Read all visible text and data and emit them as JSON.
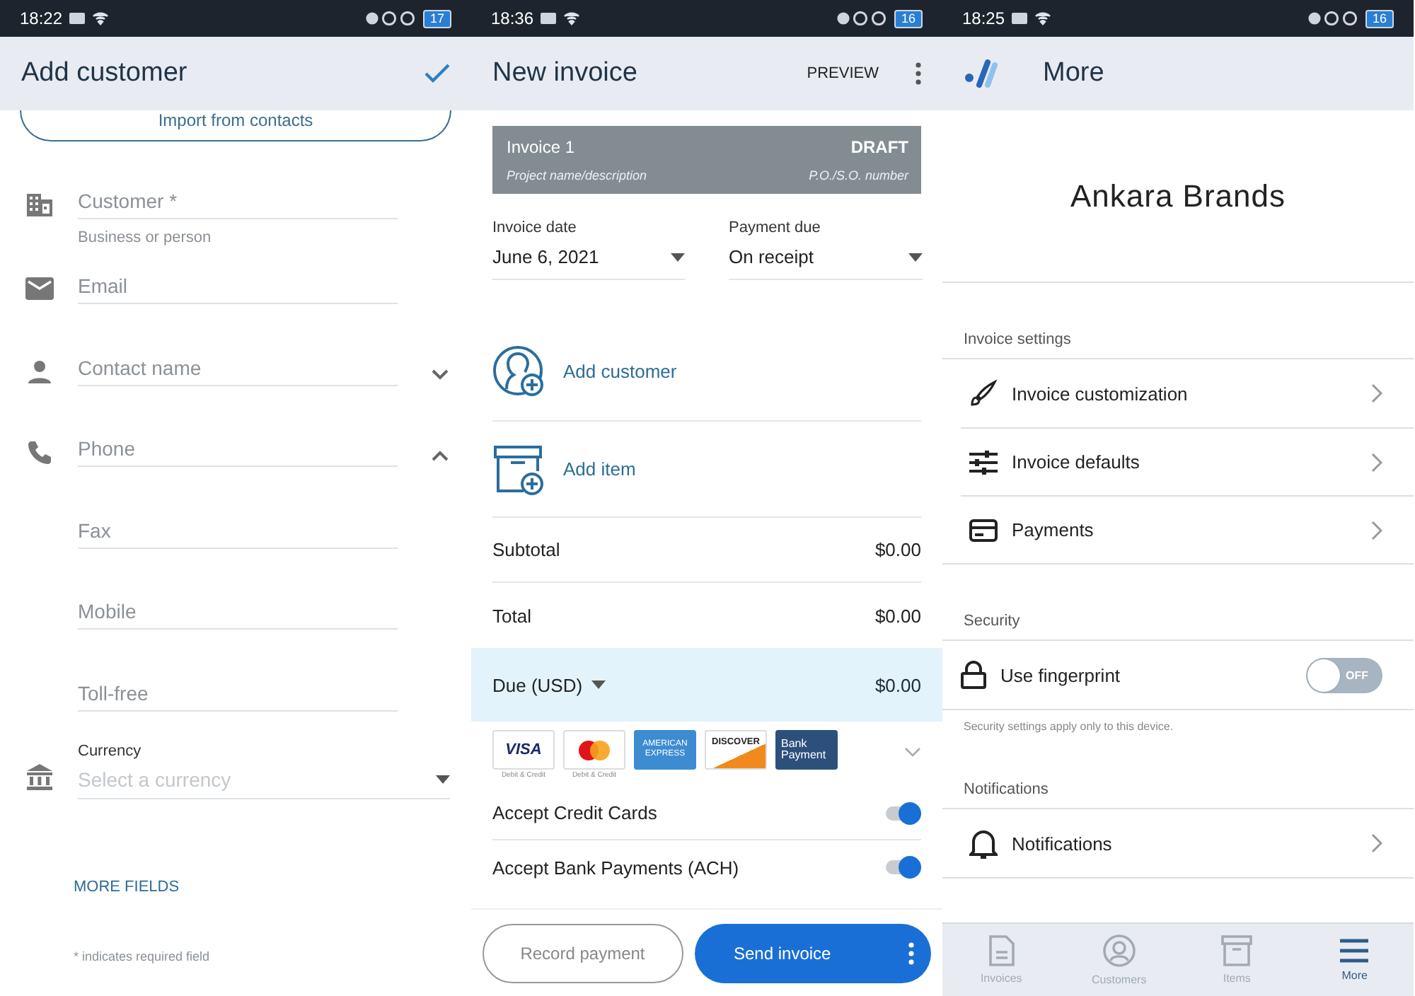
{
  "add_customer_screen": {
    "status_bar": {
      "time": "18:22",
      "battery": "17"
    },
    "app_bar": {
      "title": "Add customer"
    },
    "import_button": "Import from contacts",
    "fields": [
      {
        "placeholder": "Customer *",
        "helper": "Business or person"
      },
      {
        "placeholder": "Email"
      },
      {
        "placeholder": "Contact name",
        "expanded": false
      },
      {
        "placeholder": "Phone",
        "expanded": true
      },
      {
        "placeholder": "Fax"
      },
      {
        "placeholder": "Mobile"
      },
      {
        "placeholder": "Toll-free"
      }
    ],
    "currency": {
      "label": "Currency",
      "placeholder": "Select a currency"
    },
    "more_fields_link": "MORE FIELDS",
    "footnote": "* indicates required field"
  },
  "new_invoice_screen": {
    "status_bar": {
      "time": "18:36",
      "battery": "16"
    },
    "app_bar": {
      "title": "New invoice",
      "action": "PREVIEW"
    },
    "invoice_header": {
      "title": "Invoice 1",
      "status": "DRAFT",
      "description_placeholder": "Project name/description",
      "po_placeholder": "P.O./S.O. number"
    },
    "date_fields": [
      {
        "label": "Invoice date",
        "value": "June 6, 2021"
      },
      {
        "label": "Payment due",
        "value": "On receipt"
      }
    ],
    "add_actions": [
      "Add customer",
      "Add item"
    ],
    "totals": [
      {
        "label": "Subtotal",
        "amount": "$0.00"
      },
      {
        "label": "Total",
        "amount": "$0.00"
      }
    ],
    "amount_due": {
      "label": "Due (USD)",
      "amount": "$0.00"
    },
    "payment_methods": [
      {
        "label": "VISA",
        "caption": "Debit & Credit"
      },
      {
        "caption": "Debit & Credit"
      },
      {
        "label": "AMERICAN EXPRESS"
      },
      {
        "label": "DISCOVER"
      },
      {
        "label": "Bank Payment"
      }
    ],
    "toggles": [
      {
        "label": "Accept Credit Cards",
        "on": true
      },
      {
        "label": "Accept Bank Payments (ACH)",
        "on": true
      }
    ],
    "buttons": {
      "record": "Record payment",
      "send": "Send invoice"
    }
  },
  "more_screen": {
    "status_bar": {
      "time": "18:25",
      "battery": "16"
    },
    "app_bar": {
      "title": "More"
    },
    "business_name": "Ankara Brands",
    "sections": [
      {
        "title": "Invoice settings",
        "items": [
          {
            "kind": "link",
            "label": "Invoice customization"
          },
          {
            "kind": "link",
            "label": "Invoice defaults"
          },
          {
            "kind": "link",
            "label": "Payments"
          }
        ]
      },
      {
        "title": "Security",
        "items": [
          {
            "kind": "toggle",
            "label": "Use fingerprint",
            "on": false,
            "toggle_text": "OFF"
          }
        ],
        "note": "Security settings apply only to this device."
      },
      {
        "title": "Notifications",
        "items": [
          {
            "kind": "link",
            "label": "Notifications"
          }
        ]
      }
    ],
    "bottom_nav": [
      {
        "label": "Invoices",
        "selected": false
      },
      {
        "label": "Customers",
        "selected": false
      },
      {
        "label": "Items",
        "selected": false
      },
      {
        "label": "More",
        "selected": true
      }
    ]
  }
}
